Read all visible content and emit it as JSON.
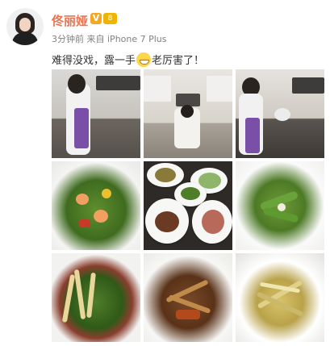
{
  "user": {
    "name": "佟丽娅",
    "verified_badge": "V",
    "level_badge": "8"
  },
  "meta": {
    "time": "3分钟前",
    "source_prefix": "来自",
    "source": "iPhone 7 Plus"
  },
  "post": {
    "text_before": "难得没戏，露一手",
    "emoji": "grin-emoji",
    "text_after": "老厉害了！"
  },
  "photos": [
    {
      "name": "photo-cooking-1"
    },
    {
      "name": "photo-cooking-2"
    },
    {
      "name": "photo-cooking-3"
    },
    {
      "name": "photo-dish-shrimp-broccoli"
    },
    {
      "name": "photo-dishes-table"
    },
    {
      "name": "photo-dish-green-beans"
    },
    {
      "name": "photo-dish-greens"
    },
    {
      "name": "photo-dish-stir-fry"
    },
    {
      "name": "photo-dish-leek"
    }
  ],
  "colors": {
    "name": "#eb7350",
    "meta": "#808080",
    "text": "#333333"
  }
}
